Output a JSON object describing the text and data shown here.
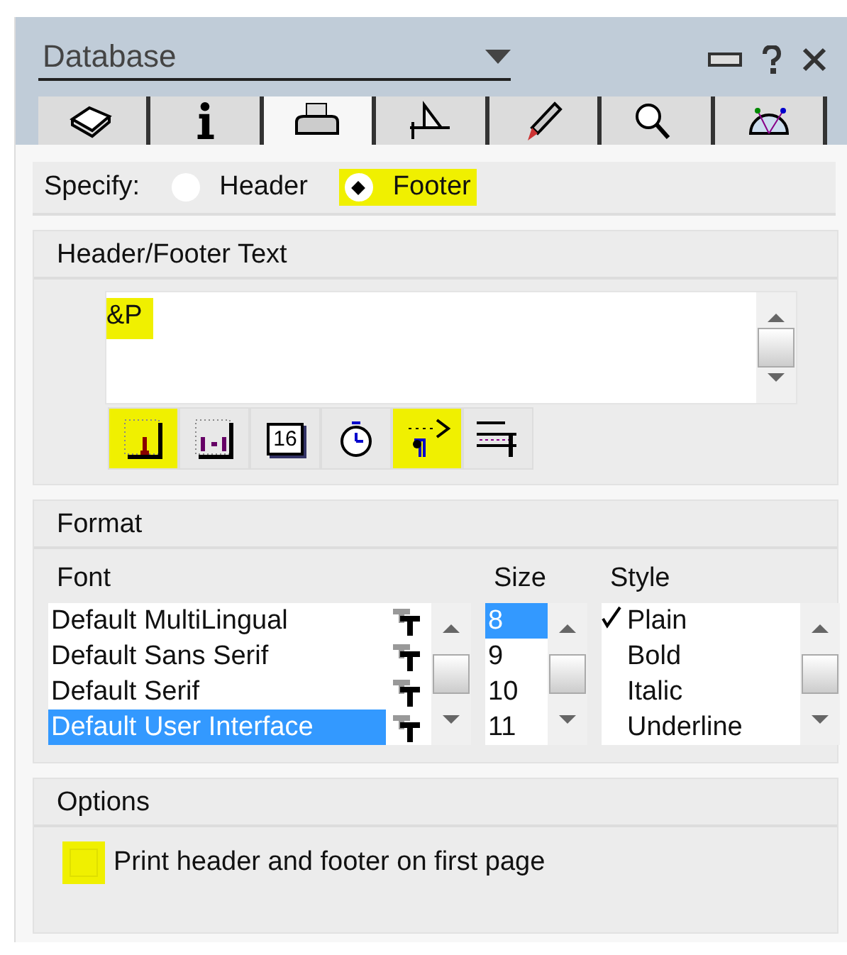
{
  "window": {
    "title": "Database"
  },
  "tabs": [
    {
      "kind": "book",
      "selected": false
    },
    {
      "kind": "info",
      "selected": false
    },
    {
      "kind": "printer",
      "selected": true
    },
    {
      "kind": "ruler",
      "selected": false
    },
    {
      "kind": "brush",
      "selected": false
    },
    {
      "kind": "magnifier",
      "selected": false
    },
    {
      "kind": "gauge",
      "selected": false
    }
  ],
  "specify": {
    "label": "Specify:",
    "options": [
      {
        "label": "Header",
        "selected": false,
        "highlighted": false
      },
      {
        "label": "Footer",
        "selected": true,
        "highlighted": true
      }
    ]
  },
  "header_footer": {
    "title": "Header/Footer Text",
    "text": "&P",
    "text_highlighted": true,
    "buttons": [
      {
        "kind": "page-number",
        "highlighted": true
      },
      {
        "kind": "page-count",
        "highlighted": false
      },
      {
        "kind": "date",
        "label": "16",
        "highlighted": false
      },
      {
        "kind": "time",
        "highlighted": false
      },
      {
        "kind": "tab",
        "highlighted": true
      },
      {
        "kind": "align",
        "highlighted": false
      }
    ]
  },
  "format": {
    "title": "Format",
    "font": {
      "label": "Font",
      "items": [
        {
          "label": "Default MultiLingual",
          "selected": false
        },
        {
          "label": "Default Sans Serif",
          "selected": false
        },
        {
          "label": "Default Serif",
          "selected": false
        },
        {
          "label": "Default User Interface",
          "selected": true
        }
      ]
    },
    "size": {
      "label": "Size",
      "items": [
        {
          "label": "8",
          "selected": true
        },
        {
          "label": "9",
          "selected": false
        },
        {
          "label": "10",
          "selected": false
        },
        {
          "label": "11",
          "selected": false
        }
      ]
    },
    "style": {
      "label": "Style",
      "items": [
        {
          "label": "Plain",
          "checked": true
        },
        {
          "label": "Bold",
          "checked": false
        },
        {
          "label": "Italic",
          "checked": false
        },
        {
          "label": "Underline",
          "checked": false
        }
      ]
    }
  },
  "options": {
    "title": "Options",
    "checkbox": {
      "label": "Print header and footer on first page",
      "checked": false,
      "highlighted": true
    }
  }
}
